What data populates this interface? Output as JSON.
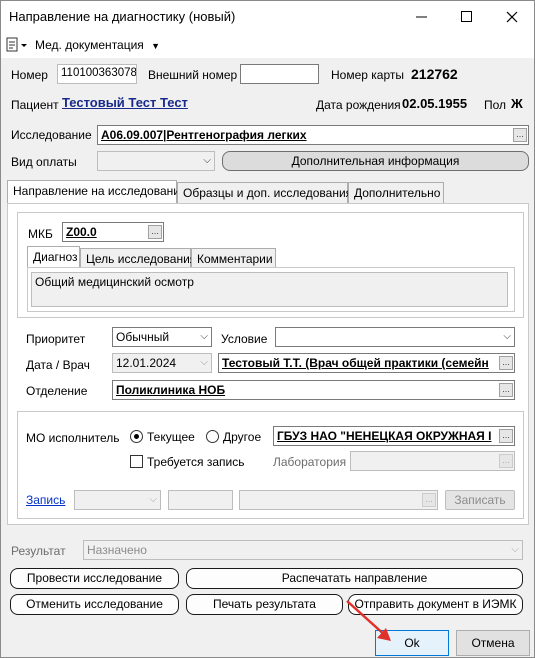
{
  "window": {
    "title": "Направление на диагностику (новый)"
  },
  "menu": {
    "doc_menu_label": "Мед. документация"
  },
  "header": {
    "number_label": "Номер",
    "number_value": "110100363078",
    "external_number_label": "Внешний номер",
    "external_number_value": "",
    "card_number_label": "Номер карты",
    "card_number_value": "212762",
    "patient_label": "Пациент",
    "patient_name": "Тестовый Тест Тест",
    "birth_date_label": "Дата рождения",
    "birth_date_value": "02.05.1955",
    "sex_label": "Пол",
    "sex_value": "Ж"
  },
  "study": {
    "label": "Исследование",
    "value": "A06.09.007|Рентгенография легких",
    "payment_label": "Вид оплаты",
    "payment_value": "",
    "additional_info_button": "Дополнительная информация"
  },
  "main_tabs": [
    "Направление на исследование",
    "Образцы и доп. исследования",
    "Дополнительно"
  ],
  "mkb": {
    "label": "МКБ",
    "value": "Z00.0",
    "tabs": [
      "Диагноз",
      "Цель исследования",
      "Комментарии"
    ],
    "diagnosis_text": "Общий медицинский осмотр"
  },
  "params": {
    "priority_label": "Приоритет",
    "priority_value": "Обычный",
    "condition_label": "Условие",
    "condition_value": "",
    "date_doctor_label": "Дата / Врач",
    "date_value": "12.01.2024",
    "doctor_value": "Тестовый Т.Т. (Врач общей практики (семейн",
    "department_label": "Отделение",
    "department_value": "Поликлиника НОБ"
  },
  "executor": {
    "mo_label": "МО исполнитель",
    "current_label": "Текущее",
    "other_label": "Другое",
    "selected": "Текущее",
    "mo_value": "ГБУЗ НАО \"НЕНЕЦКАЯ ОКРУЖНАЯ I",
    "requires_booking_label": "Требуется запись",
    "requires_booking_checked": false,
    "lab_label": "Лаборатория",
    "lab_value": ""
  },
  "booking": {
    "link_label": "Запись",
    "record_button": "Записать"
  },
  "result": {
    "label": "Результат",
    "value": "Назначено"
  },
  "actions": {
    "perform": "Провести исследование",
    "print_referral": "Распечатать направление",
    "cancel_study": "Отменить исследование",
    "print_result": "Печать результата",
    "send_iemk": "Отправить документ в ИЭМК",
    "ok": "Ok",
    "cancel": "Отмена"
  },
  "colors": {
    "accent": "#0078d7",
    "link": "#0033cc",
    "annotation_arrow": "#e0302a"
  }
}
